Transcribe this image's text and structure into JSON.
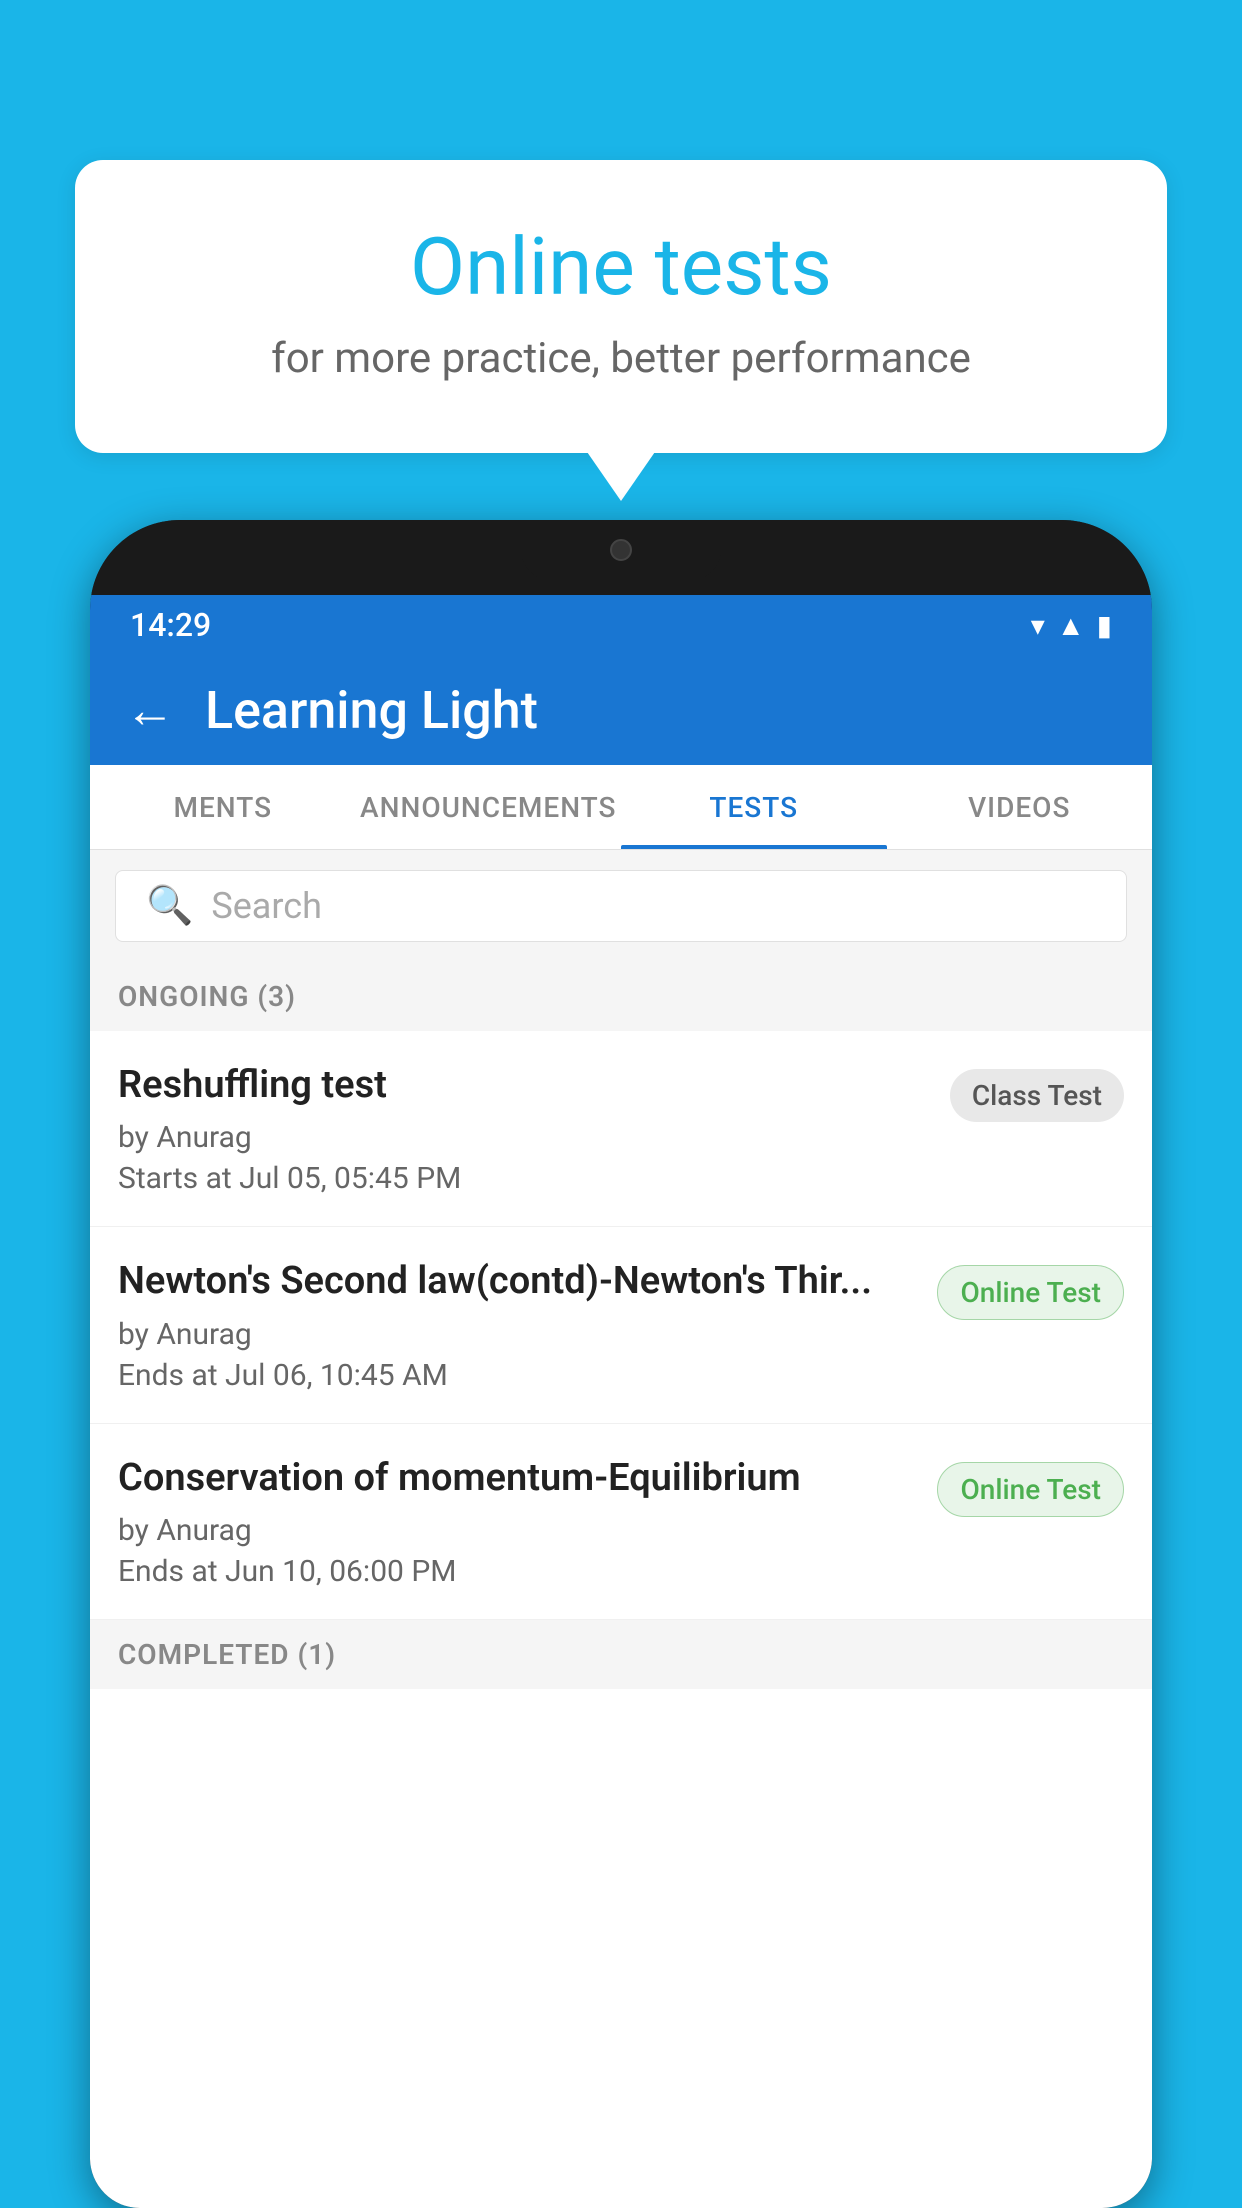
{
  "background_color": "#1ab5e8",
  "speech_bubble": {
    "title": "Online tests",
    "subtitle": "for more practice, better performance"
  },
  "phone": {
    "status_bar": {
      "time": "14:29",
      "icons": [
        "wifi",
        "signal",
        "battery"
      ]
    },
    "app_bar": {
      "title": "Learning Light",
      "back_label": "←"
    },
    "tabs": [
      {
        "label": "MENTS",
        "active": false
      },
      {
        "label": "ANNOUNCEMENTS",
        "active": false
      },
      {
        "label": "TESTS",
        "active": true
      },
      {
        "label": "VIDEOS",
        "active": false
      }
    ],
    "search": {
      "placeholder": "Search"
    },
    "sections": [
      {
        "header": "ONGOING (3)",
        "items": [
          {
            "title": "Reshuffling test",
            "author": "by Anurag",
            "date": "Starts at  Jul 05, 05:45 PM",
            "badge": "Class Test",
            "badge_type": "class"
          },
          {
            "title": "Newton's Second law(contd)-Newton's Thir...",
            "author": "by Anurag",
            "date": "Ends at  Jul 06, 10:45 AM",
            "badge": "Online Test",
            "badge_type": "online"
          },
          {
            "title": "Conservation of momentum-Equilibrium",
            "author": "by Anurag",
            "date": "Ends at  Jun 10, 06:00 PM",
            "badge": "Online Test",
            "badge_type": "online"
          }
        ]
      },
      {
        "header": "COMPLETED (1)",
        "items": []
      }
    ]
  }
}
